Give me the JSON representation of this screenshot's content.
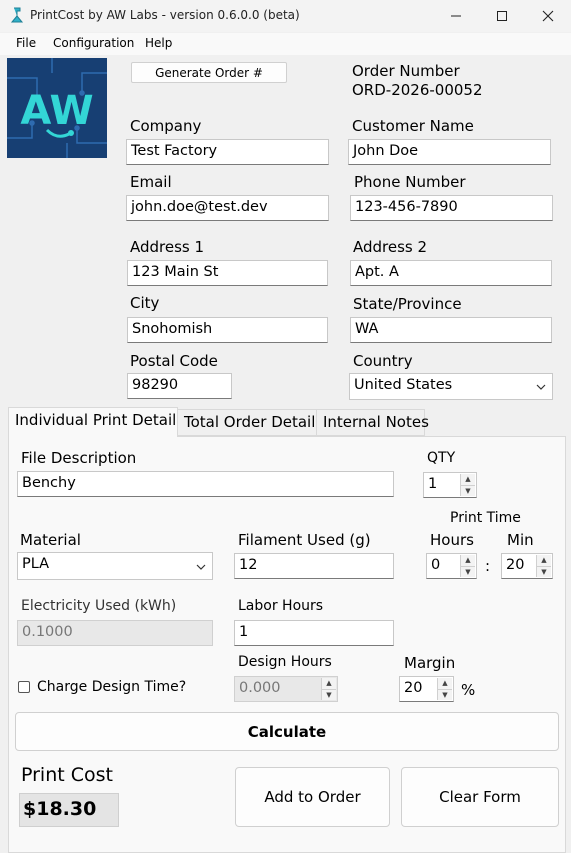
{
  "window": {
    "title": "PrintCost by AW Labs - version 0.6.0.0 (beta)",
    "minimize_icon": "minimize-icon",
    "maximize_icon": "maximize-icon",
    "close_icon": "close-icon"
  },
  "menu": {
    "items": [
      "File",
      "Configuration",
      "Help"
    ]
  },
  "logo": {
    "text": "AW",
    "background": "#1b4f8c",
    "accent": "#33d6d6"
  },
  "order": {
    "generate_button": "Generate Order #",
    "number_label": "Order Number",
    "number_value": "ORD-2026-00052"
  },
  "customer": {
    "company_label": "Company",
    "company_value": "Test Factory",
    "name_label": "Customer Name",
    "name_value": "John Doe",
    "email_label": "Email",
    "email_value": "john.doe@test.dev",
    "phone_label": "Phone Number",
    "phone_value": "123-456-7890",
    "address1_label": "Address 1",
    "address1_value": "123 Main St",
    "address2_label": "Address 2",
    "address2_value": "Apt. A",
    "city_label": "City",
    "city_value": "Snohomish",
    "state_label": "State/Province",
    "state_value": "WA",
    "postal_label": "Postal Code",
    "postal_value": "98290",
    "country_label": "Country",
    "country_value": "United States"
  },
  "tabs": [
    "Individual Print Details",
    "Total Order Details",
    "Internal Notes"
  ],
  "print": {
    "file_desc_label": "File Description",
    "file_desc_value": "Benchy",
    "qty_label": "QTY",
    "qty_value": "1",
    "material_label": "Material",
    "material_value": "PLA",
    "filament_label": "Filament Used (g)",
    "filament_value": "12",
    "print_time_label": "Print Time",
    "hours_label": "Hours",
    "hours_value": "0",
    "time_sep": ":",
    "min_label": "Min",
    "min_value": "20",
    "electricity_label": "Electricity Used (kWh)",
    "electricity_value": "0.1000",
    "labor_label": "Labor Hours",
    "labor_value": "1",
    "design_hours_label": "Design Hours",
    "design_hours_value": "0.000",
    "charge_design_label": "Charge Design Time?",
    "margin_label": "Margin",
    "margin_value": "20",
    "margin_unit": "%",
    "calculate_button": "Calculate",
    "cost_label": "Print Cost",
    "cost_value": "$18.30",
    "add_button": "Add to Order",
    "clear_button": "Clear Form"
  }
}
